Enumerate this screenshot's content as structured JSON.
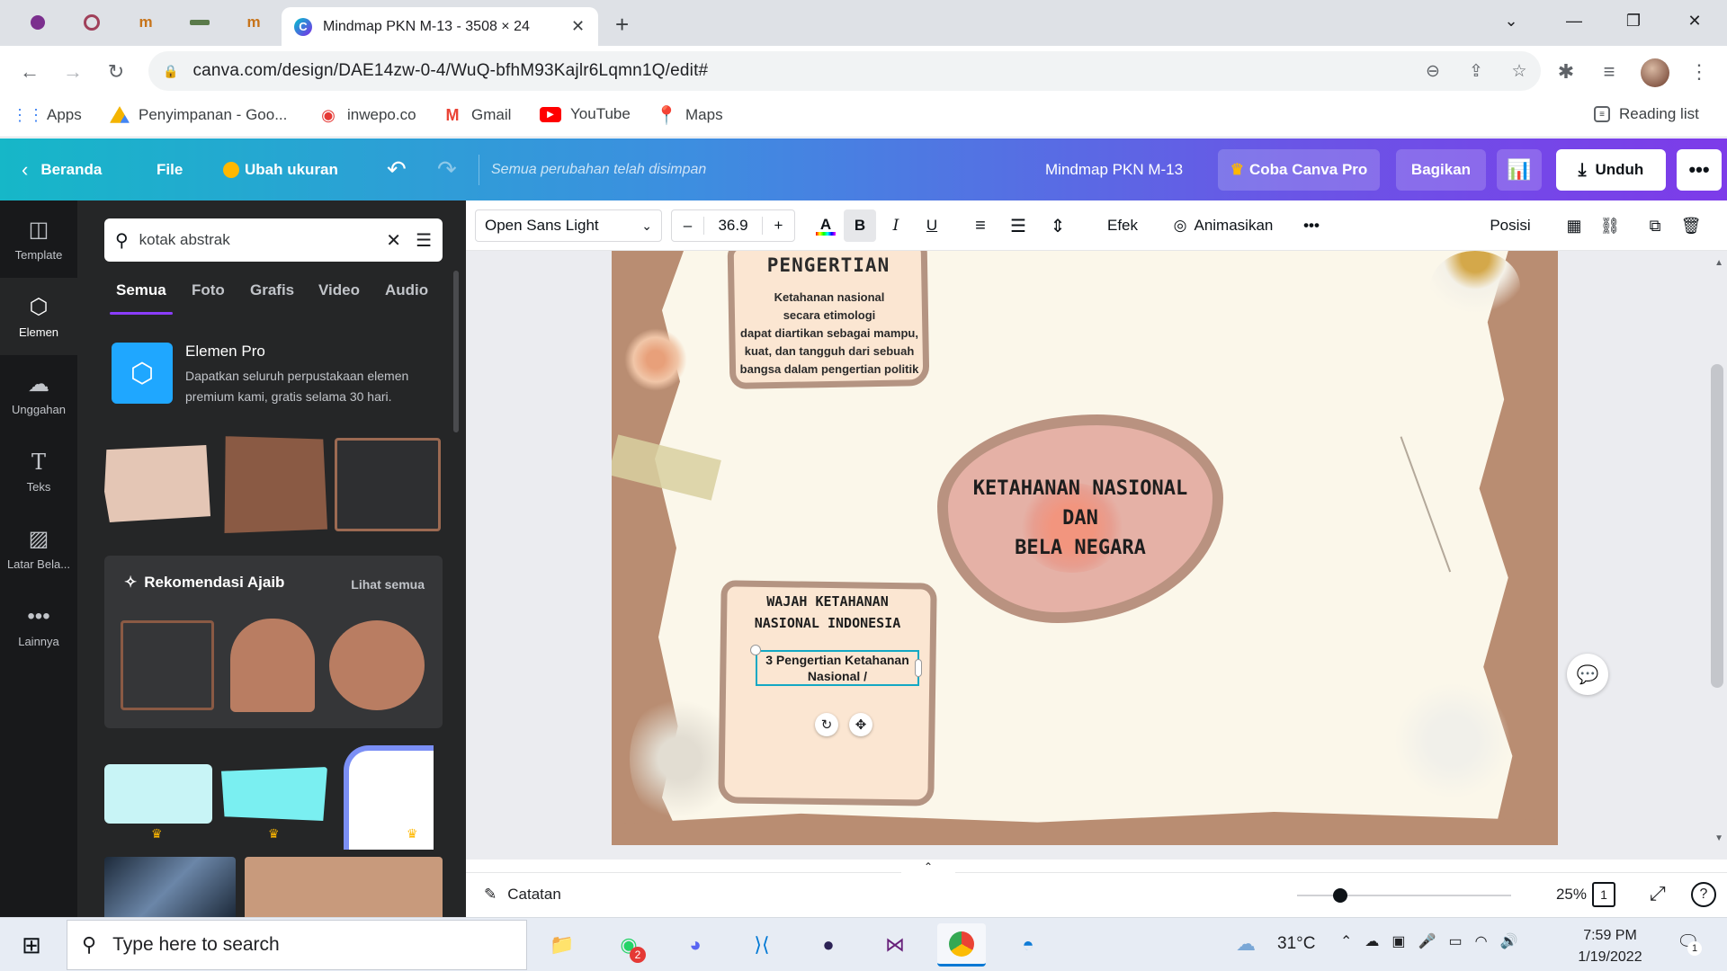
{
  "browser": {
    "active_tab_title": "Mindmap PKN M-13 - 3508 × 24",
    "url": "canva.com/design/DAE14zw-0-4/WuQ-bfhM93Kajlr6Lqmn1Q/edit#",
    "bookmarks": [
      "Apps",
      "Penyimpanan - Goo...",
      "inwepo.co",
      "Gmail",
      "YouTube",
      "Maps"
    ],
    "reading_list": "Reading list"
  },
  "canva": {
    "header": {
      "home": "Beranda",
      "file": "File",
      "resize": "Ubah ukuran",
      "saved_status": "Semua perubahan telah disimpan",
      "design_title": "Mindmap PKN M-13",
      "try_pro": "Coba Canva Pro",
      "share": "Bagikan",
      "download": "Unduh"
    },
    "sidebar": [
      {
        "label": "Template",
        "icon": "template-icon"
      },
      {
        "label": "Elemen",
        "icon": "elements-icon"
      },
      {
        "label": "Unggahan",
        "icon": "upload-icon"
      },
      {
        "label": "Teks",
        "icon": "text-icon"
      },
      {
        "label": "Latar Bela...",
        "icon": "background-icon"
      },
      {
        "label": "Lainnya",
        "icon": "more-icon"
      }
    ],
    "panel": {
      "search_value": "kotak abstrak",
      "tabs": [
        "Semua",
        "Foto",
        "Grafis",
        "Video",
        "Audio"
      ],
      "pro_title": "Elemen Pro",
      "pro_desc": "Dapatkan seluruh perpustakaan elemen premium kami, gratis selama 30 hari.",
      "magic_title": "Rekomendasi Ajaib",
      "see_all": "Lihat semua"
    },
    "toolbar": {
      "font": "Open Sans Light",
      "font_size": "36.9",
      "effects": "Efek",
      "animate": "Animasikan",
      "position": "Posisi"
    },
    "design": {
      "box1_title": "PENGERTIAN",
      "box1_text": [
        "Ketahanan nasional",
        "secara etimologi",
        "dapat diartikan sebagai mampu,",
        "kuat, dan tangguh dari sebuah",
        "bangsa dalam pengertian politik"
      ],
      "center_title": [
        "KETAHANAN NASIONAL",
        "DAN",
        "BELA NEGARA"
      ],
      "box2_title": [
        "WAJAH KETAHANAN",
        "NASIONAL INDONESIA"
      ],
      "box2_text": [
        "3 Pengertian Ketahanan",
        "Nasional /"
      ]
    },
    "bottom": {
      "notes": "Catatan",
      "zoom": "25%",
      "page_number": "1",
      "zoom_level": 0.2
    }
  },
  "taskbar": {
    "search_placeholder": "Type here to search",
    "weather": "31°C",
    "time": "7:59 PM",
    "date": "1/19/2022",
    "whatsapp_badge": "2",
    "notif_count": "1"
  },
  "colors": {
    "canva_purple": "#7d3be9",
    "canva_teal": "#16b7c8",
    "selection": "#13a8c4"
  }
}
